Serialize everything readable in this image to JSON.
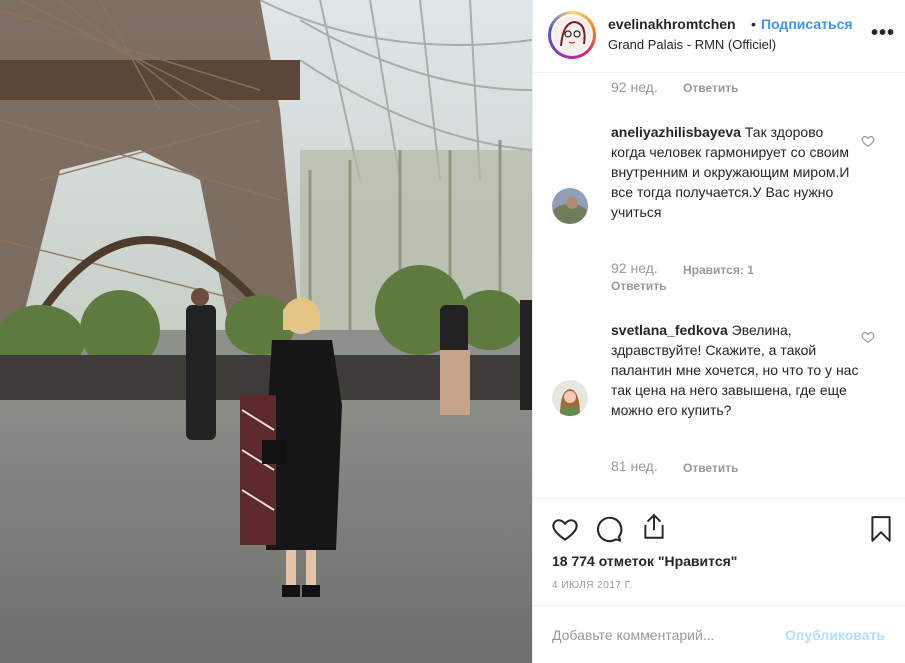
{
  "post": {
    "username": "evelinakhromtchen",
    "separator": "•",
    "follow_label": "Подписаться",
    "location": "Grand Palais - RMN (Officiel)",
    "more_label": "•••"
  },
  "comments": [
    {
      "time": "92 нед.",
      "reply_label": "Ответить"
    },
    {
      "username": "aneliyazhilisbayeva",
      "text": "Так здорово когда человек гармонирует со своим внутренним и окружающим миром.И все тогда получается.У Вас нужно учиться",
      "time": "92 нед.",
      "likes": "Нравится: 1",
      "reply_label": "Ответить"
    },
    {
      "username": "svetlana_fedkova",
      "text": "Эвелина, здравствуйте! Скажите, а такой палантин мне хочется, но что то у нас так цена на него завышена, где еще можно его купить?",
      "time": "81 нед.",
      "reply_label": "Ответить"
    }
  ],
  "actions": {
    "likes_count": "18 774 отметок \"Нравится\"",
    "date": "4 ИЮЛЯ 2017 Г.",
    "comment_placeholder": "Добавьте комментарий...",
    "publish_label": "Опубликовать"
  },
  "colors": {
    "link_blue": "#3897f0",
    "muted_gray": "#999999",
    "disabled_blue": "#b2dffc",
    "text": "#262626",
    "border": "#efefef"
  },
  "icons": [
    "heart-icon",
    "comment-icon",
    "share-icon",
    "bookmark-icon",
    "more-options-icon"
  ]
}
